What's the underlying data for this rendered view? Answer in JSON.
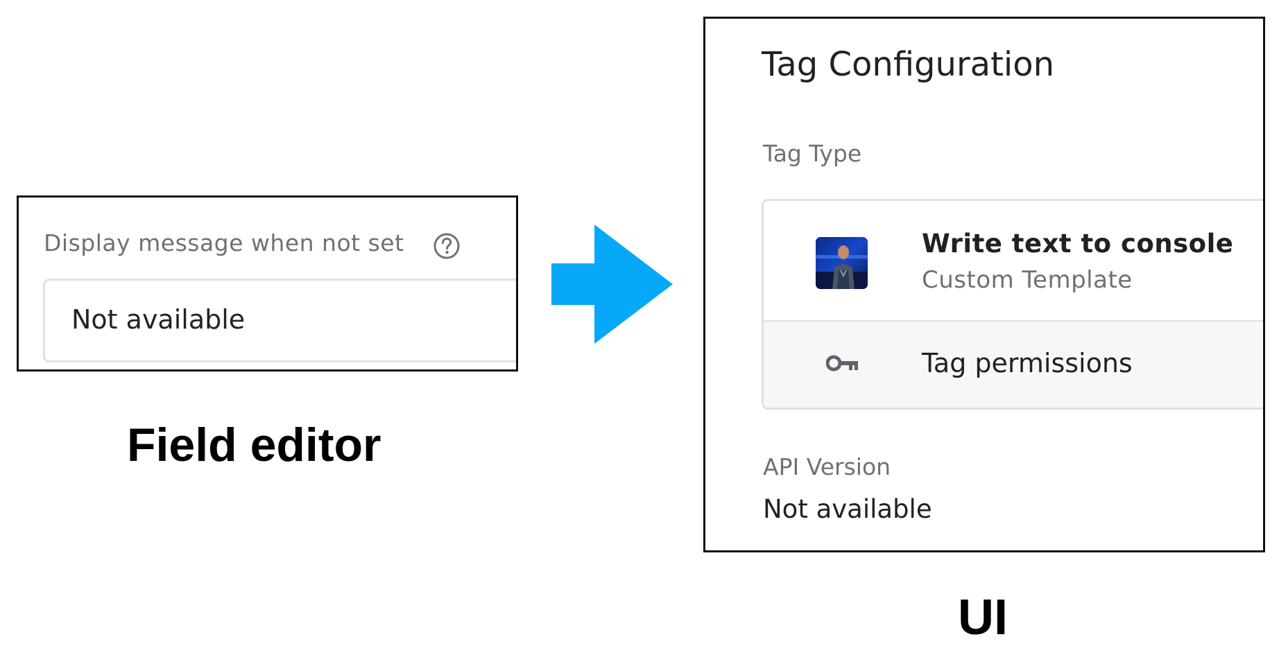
{
  "field_editor": {
    "label": "Display message when not set",
    "help_icon": "help-circle-icon",
    "input_value": "Not available"
  },
  "captions": {
    "left": "Field editor",
    "right": "UI"
  },
  "arrow": {
    "icon": "right-arrow-icon",
    "color": "#08a8f8"
  },
  "ui_panel": {
    "title": "Tag Configuration",
    "tag_type_label": "Tag Type",
    "template": {
      "name": "Write text to console",
      "type": "Custom Template",
      "avatar_icon": "template-avatar"
    },
    "permissions": {
      "icon": "key-icon",
      "label": "Tag permissions"
    },
    "api_version": {
      "label": "API Version",
      "value": "Not available"
    }
  }
}
